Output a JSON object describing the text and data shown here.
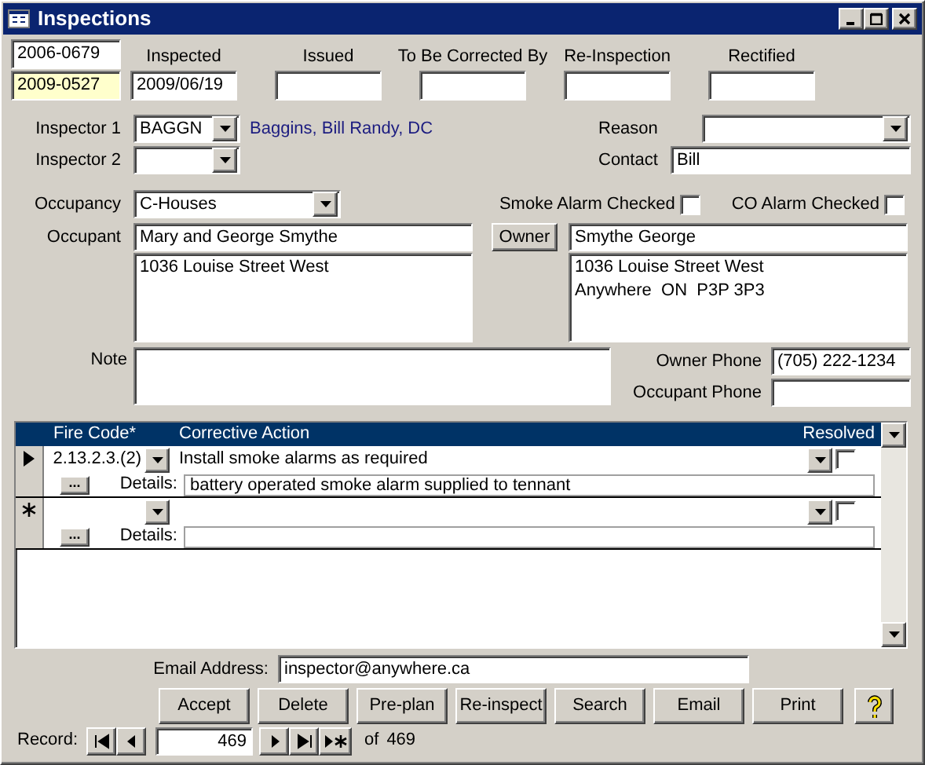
{
  "window": {
    "title": "Inspections"
  },
  "header": {
    "file_numbers": [
      {
        "value": "2006-0679",
        "highlighted": false
      },
      {
        "value": "2009-0527",
        "highlighted": true
      }
    ],
    "dates": [
      {
        "label": "Inspected",
        "value": "2009/06/19"
      },
      {
        "label": "Issued"
      },
      {
        "label": "To Be Corrected By"
      },
      {
        "label": "Re-Inspection"
      },
      {
        "label": "Rectified"
      }
    ]
  },
  "inspectors": [
    {
      "label": "Inspector 1",
      "code": "BAGGN",
      "name": "Baggins, Bill Randy, DC"
    },
    {
      "label": "Inspector 2"
    }
  ],
  "reason": {
    "label": "Reason"
  },
  "contact": {
    "label": "Contact",
    "value": "Bill"
  },
  "occupancy": {
    "label": "Occupancy",
    "value": "C-Houses"
  },
  "alarms": [
    {
      "label": "Smoke Alarm Checked",
      "checked": false
    },
    {
      "label": "CO Alarm Checked",
      "checked": false
    }
  ],
  "occupant": {
    "label": "Occupant",
    "name": "Mary and George Smythe",
    "address": "1036 Louise Street West"
  },
  "owner": {
    "button": "Owner",
    "name": "Smythe George",
    "address": "1036 Louise Street West\nAnywhere  ON  P3P 3P3"
  },
  "note": {
    "label": "Note"
  },
  "phones": [
    {
      "label": "Owner Phone",
      "value": "(705) 222-1234"
    },
    {
      "label": "Occupant Phone"
    }
  ],
  "subform": {
    "columns": [
      "Fire Code*",
      "Corrective Action",
      "Resolved"
    ],
    "rows": [
      {
        "kind": "current",
        "fire_code": "2.13.2.3.(2)",
        "action": "Install smoke alarms as required",
        "resolved": false,
        "more": "...",
        "details_label": "Details:",
        "details": "battery operated smoke alarm supplied to tennant"
      },
      {
        "kind": "new",
        "resolved": false,
        "more": "...",
        "details_label": "Details:"
      }
    ]
  },
  "email": {
    "label": "Email Address:",
    "value": "inspector@anywhere.ca"
  },
  "buttons": [
    "Accept",
    "Delete",
    "Pre-plan",
    "Re-inspect",
    "Search",
    "Email",
    "Print"
  ],
  "record_nav": {
    "label": "Record:",
    "current": "469",
    "of": "of",
    "total": "469"
  }
}
